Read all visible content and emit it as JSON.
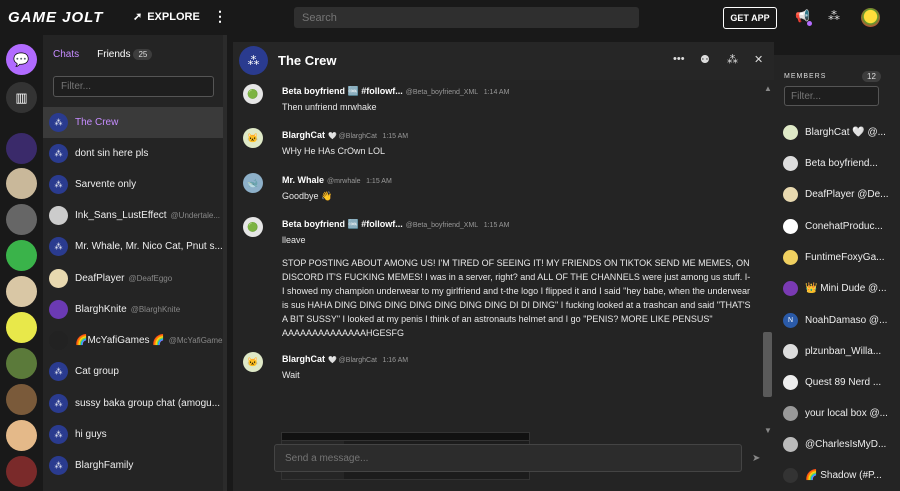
{
  "topbar": {
    "logo": "GAME JOLT",
    "explore": "EXPLORE",
    "search_placeholder": "Search",
    "get_app": "GET APP"
  },
  "sidebar": {
    "tabs": {
      "chats": "Chats",
      "friends": "Friends",
      "friends_count": "25"
    },
    "filter_placeholder": "Filter...",
    "chats": [
      {
        "name": "The Crew",
        "handle": ""
      },
      {
        "name": "dont sin here pls",
        "handle": ""
      },
      {
        "name": "Sarvente only",
        "handle": ""
      },
      {
        "name": "Ink_Sans_LustEffect",
        "handle": "@Undertale..."
      },
      {
        "name": "Mr. Whale, Mr. Nico Cat, Pnut s...",
        "handle": ""
      },
      {
        "name": "DeafPlayer",
        "handle": "@DeafEggo"
      },
      {
        "name": "BlarghKnite",
        "handle": "@BlarghKnite"
      },
      {
        "name": "🌈McYafiGames 🌈",
        "handle": "@McYafiGames"
      },
      {
        "name": "Cat group",
        "handle": ""
      },
      {
        "name": "sussy baka group chat (amogu...",
        "handle": ""
      },
      {
        "name": "hi guys",
        "handle": ""
      },
      {
        "name": "BlarghFamily",
        "handle": ""
      }
    ]
  },
  "room": {
    "title": "The Crew",
    "messages": [
      {
        "name": "Beta boyfriend 🆒 #followf...",
        "handle": "@Beta_boyfriend_XML",
        "time": "1:14 AM",
        "text": "Then unfriend mrwhake"
      },
      {
        "name": "BlarghCat",
        "handle": "🤍 @BlarghCat",
        "time": "1:15 AM",
        "text": "WHy He HAs CrOwn LOL"
      },
      {
        "name": "Mr. Whale",
        "handle": "@mrwhale",
        "time": "1:15 AM",
        "text": "Goodbye 👋"
      },
      {
        "name": "Beta boyfriend 🆒 #followf...",
        "handle": "@Beta_boyfriend_XML",
        "time": "1:15 AM",
        "text": "lleave"
      },
      {
        "name": "",
        "handle": "",
        "time": "",
        "text": "STOP POSTING ABOUT AMONG US! I'M TIRED OF SEEING IT! MY FRIENDS ON TIKTOK SEND ME MEMES, ON DISCORD IT'S FUCKING MEMES! I was in a server, right? and ALL OF THE CHANNELS were just among us stuff. I-I showed my champion underwear to my girlfriend and t-the logo I flipped it and I said \"hey babe, when the underwear is sus HAHA DING DING DING DING DING DING DING DI DI DING\" I fucking looked at a trashcan and said \"THAT'S A BIT SUSSY\" I looked at my penis I think of an astronauts helmet and I go \"PENIS? MORE LIKE PENSUS\" AAAAAAAAAAAAAAHGESFG"
      },
      {
        "name": "BlarghCat",
        "handle": "🤍 @BlarghCat",
        "time": "1:16 AM",
        "text": "Wait"
      }
    ],
    "composer_placeholder": "Send a message..."
  },
  "members": {
    "title": "MEMBERS",
    "count": "12",
    "filter_placeholder": "Filter...",
    "list": [
      "BlarghCat 🤍 @...",
      "Beta boyfriend...",
      "DeafPlayer @De...",
      "ConehatProduc...",
      "FuntimeFoxyGa...",
      "👑 Mini Dude @...",
      "NoahDamaso @...",
      "plzunban_Willa...",
      "Quest 89 Nerd ...",
      "your local box @...",
      "@CharlesIsMyD...",
      "🌈 Shadow (#P..."
    ]
  },
  "colors": {
    "accent": "#c68cff",
    "highlight": "#ccff00",
    "group_avatar": "#2a3b8f"
  }
}
